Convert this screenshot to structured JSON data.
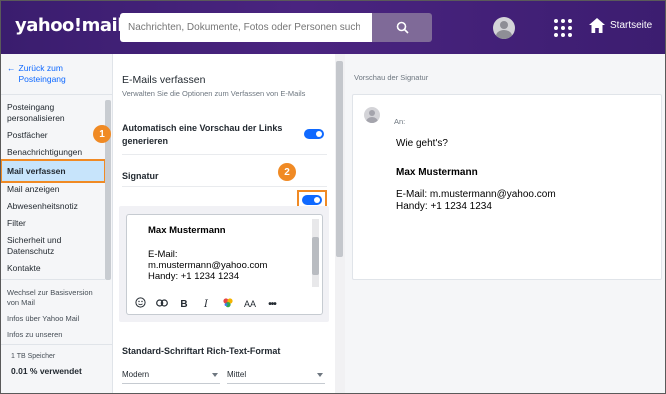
{
  "header": {
    "logo": "yahoo!mail",
    "search_placeholder": "Nachrichten, Dokumente, Fotos oder Personen such",
    "home_label": "Startseite"
  },
  "sidebar": {
    "back_label_1": "Zurück zum",
    "back_label_2": "Posteingang",
    "items": [
      {
        "label": "Posteingang"
      },
      {
        "label": "personalisieren"
      },
      {
        "label": "Postfächer"
      },
      {
        "label": "Benachrichtigungen"
      },
      {
        "label": "Mail verfassen"
      },
      {
        "label": "Mail anzeigen"
      },
      {
        "label": "Abwesenheitsnotiz"
      },
      {
        "label": "Filter"
      },
      {
        "label": "Sicherheit und"
      },
      {
        "label": "Datenschutz"
      },
      {
        "label": "Kontakte"
      }
    ],
    "links": [
      "Wechsel zur Basisversion",
      "von Mail",
      "Infos über Yahoo Mail",
      "Infos zu unseren"
    ],
    "storage": {
      "total": "1 TB Speicher",
      "used": "0.01 % verwendet"
    }
  },
  "settings": {
    "title": "E-Mails verfassen",
    "subtitle": "Verwalten Sie die Optionen zum Verfassen von E-Mails",
    "link_preview_label_1": "Automatisch eine Vorschau der Links",
    "link_preview_label_2": "generieren",
    "link_preview_enabled": true,
    "signature_label": "Signatur",
    "signature_enabled": true,
    "signature": {
      "name": "Max Mustermann",
      "email_label": "E-Mail:",
      "email": "m.mustermann@yahoo.com",
      "phone": "Handy: +1 1234 1234"
    },
    "toolbar_icons": [
      "emoji-icon",
      "link-icon",
      "bold-icon",
      "italic-icon",
      "color-icon",
      "font-size-icon",
      "more-icon"
    ],
    "font_section_label": "Standard-Schriftart Rich-Text-Format",
    "font_family": "Modern",
    "font_size": "Mittel"
  },
  "preview": {
    "label": "Vorschau der Signatur",
    "to_label": "An:",
    "body": "Wie geht's?",
    "name": "Max Mustermann",
    "email_line": "E-Mail: m.mustermann@yahoo.com",
    "phone_line": "Handy: +1 1234 1234"
  },
  "callouts": [
    "1",
    "2"
  ],
  "colors": {
    "accent": "#0f69ff",
    "header": "#3a1d6e",
    "callout": "#f08a24"
  }
}
